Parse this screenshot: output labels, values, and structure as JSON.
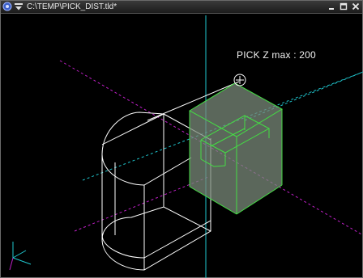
{
  "window": {
    "title": "C:\\TEMP\\PICK_DIST.tld*",
    "controls": [
      "minimize",
      "maximize",
      "close"
    ]
  },
  "viewport": {
    "background": "#000000",
    "pick_label": "PICK Z max : 200",
    "colors": {
      "x_axis": "#c020c8",
      "y_axis": "#20c8d0",
      "z_axis": "#20c8d0",
      "wireframe": "#ffffff",
      "selection": "#44dd44",
      "selection_fill": "#7a8a7a"
    },
    "icons": [
      "pick-cursor-icon",
      "axis-triad-icon"
    ]
  }
}
